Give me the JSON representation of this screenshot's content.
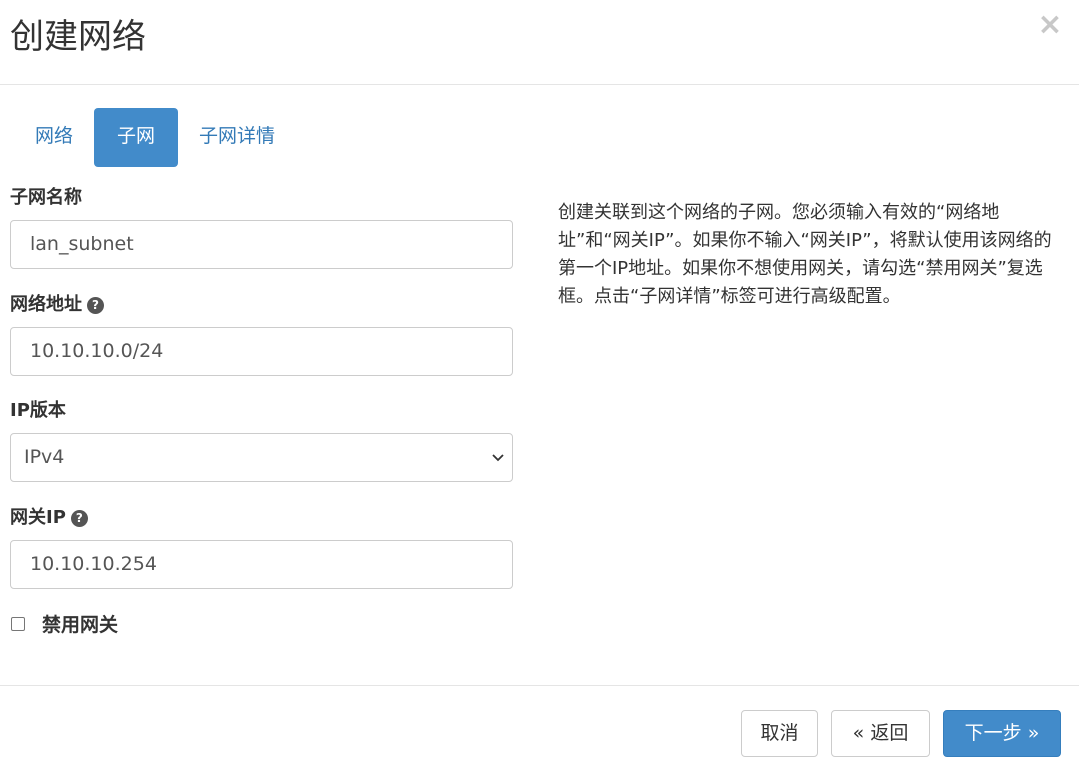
{
  "dialog": {
    "title": "创建网络",
    "close_icon": "close-icon"
  },
  "tabs": [
    {
      "label": "网络",
      "active": false
    },
    {
      "label": "子网",
      "active": true
    },
    {
      "label": "子网详情",
      "active": false
    }
  ],
  "form": {
    "subnet_name": {
      "label": "子网名称",
      "value": "lan_subnet"
    },
    "network_address": {
      "label": "网络地址",
      "value": "10.10.10.0/24",
      "help_icon": "question-circle-icon"
    },
    "ip_version": {
      "label": "IP版本",
      "selected": "IPv4"
    },
    "gateway_ip": {
      "label": "网关IP",
      "value": "10.10.10.254",
      "help_icon": "question-circle-icon"
    },
    "disable_gateway": {
      "label": "禁用网关",
      "checked": false
    }
  },
  "help_text": "创建关联到这个网络的子网。您必须输入有效的“网络地址”和“网关IP”。如果你不输入“网关IP”，将默认使用该网络的第一个IP地址。如果你不想使用网关，请勾选“禁用网关”复选框。点击“子网详情”标签可进行高级配置。",
  "footer": {
    "cancel_label": "取消",
    "back_label": "« 返回",
    "next_label": "下一步 »"
  },
  "colors": {
    "primary": "#428bca",
    "link": "#337ab7",
    "border": "#cccccc"
  }
}
